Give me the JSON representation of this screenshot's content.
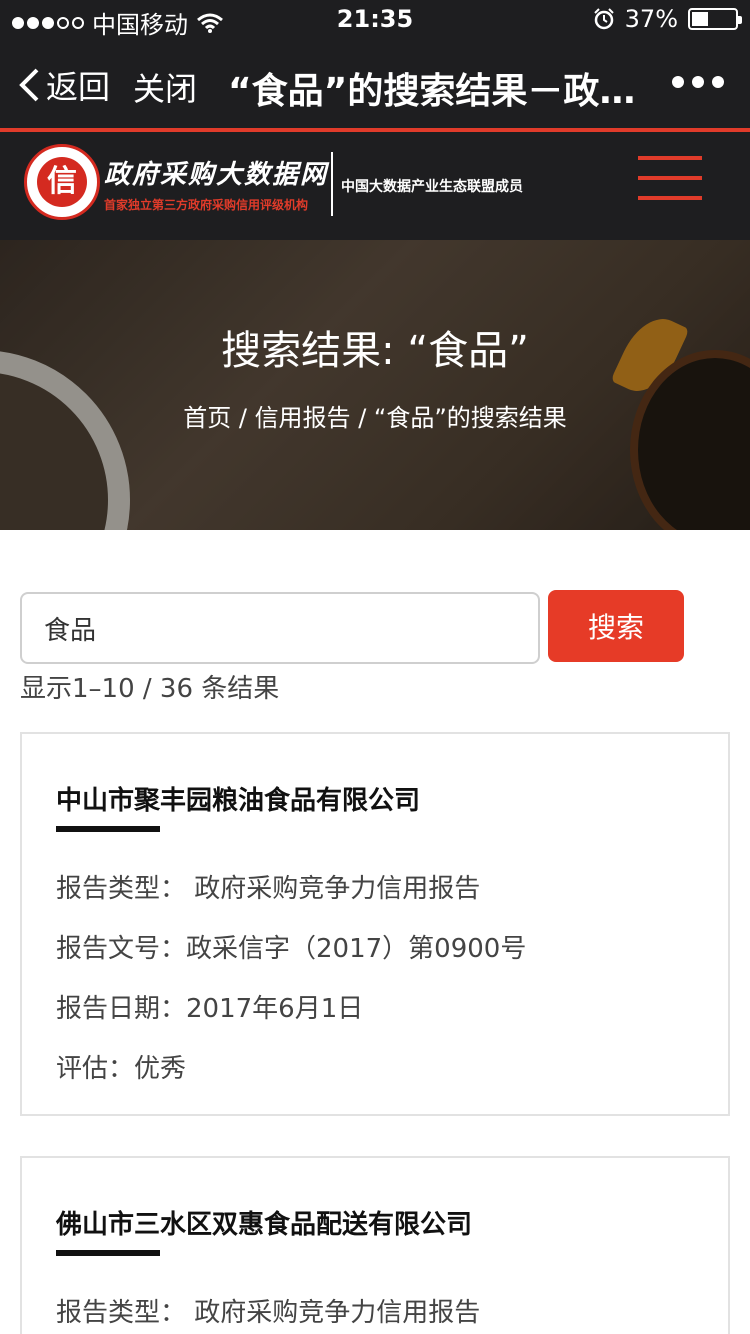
{
  "status_bar": {
    "carrier": "中国移动",
    "time": "21:35",
    "battery": "37%",
    "battery_level": 0.37
  },
  "nav_bar": {
    "back_label": "返回",
    "close_label": "关闭",
    "title": "“食品”的搜索结果－政…"
  },
  "site_header": {
    "logo_seal_char": "信",
    "logo_title": "政府采购大数据网",
    "logo_tagline": "首家独立第三方政府采购信用评级机构",
    "member_text": "中国大数据产业生态联盟成员"
  },
  "hero": {
    "title": "搜索结果: “食品”",
    "breadcrumb": {
      "home": "首页",
      "separator": " / ",
      "section": "信用报告",
      "current": "“食品”的搜索结果"
    }
  },
  "search": {
    "value": "食品",
    "button_label": "搜索",
    "result_count": "显示1–10 / 36 条结果"
  },
  "results": [
    {
      "company": "中山市聚丰园粮油食品有限公司",
      "report_type": "报告类型： 政府采购竞争力信用报告",
      "report_number": "报告文号：政采信字（2017）第0900号",
      "report_date": "报告日期：2017年6月1日",
      "rating": "评估：优秀"
    },
    {
      "company": "佛山市三水区双惠食品配送有限公司",
      "report_type": "报告类型： 政府采购竞争力信用报告"
    }
  ],
  "colors": {
    "accent_red": "#e63b27",
    "dark_bg": "#1e1e20"
  }
}
